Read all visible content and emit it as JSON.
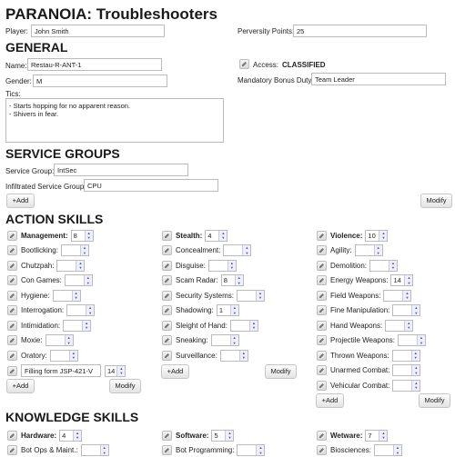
{
  "title": "PARANOIA: Troubleshooters",
  "player": {
    "label": "Player:",
    "value": "John Smith"
  },
  "perversity": {
    "label": "Perversity Points:",
    "value": "25"
  },
  "general": {
    "heading": "GENERAL",
    "name": {
      "label": "Name:",
      "value": "Restau-R-ANT-1"
    },
    "gender": {
      "label": "Gender:",
      "value": "M"
    },
    "access": {
      "label": "Access:",
      "value": "CLASSIFIED"
    },
    "duty": {
      "label": "Mandatory Bonus Duty:",
      "value": "Team Leader"
    },
    "tics": {
      "label": "Tics:",
      "lines": [
        "- Starts hopping for no apparent reason.",
        "- Shivers in fear."
      ]
    }
  },
  "service": {
    "heading": "SERVICE GROUPS",
    "group": {
      "label": "Service Group:",
      "value": "IntSec"
    },
    "infiltrated": {
      "label": "Infiltrated Service Group:",
      "value": "CPU"
    },
    "add_label": "+Add",
    "modify_label": "Modify"
  },
  "action": {
    "heading": "ACTION SKILLS",
    "add_label": "+Add",
    "modify_label": "Modify",
    "col1": {
      "head": {
        "label": "Management:",
        "value": "8"
      },
      "items": [
        {
          "label": "Bootlicking:",
          "value": ""
        },
        {
          "label": "Chutzpah:",
          "value": ""
        },
        {
          "label": "Con Games:",
          "value": ""
        },
        {
          "label": "Hygiene:",
          "value": ""
        },
        {
          "label": "Interrogation:",
          "value": ""
        },
        {
          "label": "Intimidation:",
          "value": ""
        },
        {
          "label": "Moxie:",
          "value": ""
        },
        {
          "label": "Oratory:",
          "value": ""
        }
      ],
      "custom": {
        "name": "Filling form JSP-421-V",
        "value": "14"
      }
    },
    "col2": {
      "head": {
        "label": "Stealth:",
        "value": "4"
      },
      "items": [
        {
          "label": "Concealment:",
          "value": ""
        },
        {
          "label": "Disguise:",
          "value": ""
        },
        {
          "label": "Scam Radar:",
          "value": "8"
        },
        {
          "label": "Security Systems:",
          "value": ""
        },
        {
          "label": "Shadowing:",
          "value": "1"
        },
        {
          "label": "Sleight of Hand:",
          "value": ""
        },
        {
          "label": "Sneaking:",
          "value": ""
        },
        {
          "label": "Surveillance:",
          "value": ""
        }
      ]
    },
    "col3": {
      "head": {
        "label": "Violence:",
        "value": "10"
      },
      "items": [
        {
          "label": "Agility:",
          "value": ""
        },
        {
          "label": "Demolition:",
          "value": ""
        },
        {
          "label": "Energy Weapons:",
          "value": "14"
        },
        {
          "label": "Field Weapons:",
          "value": ""
        },
        {
          "label": "Fine Manipulation:",
          "value": ""
        },
        {
          "label": "Hand Weapons:",
          "value": ""
        },
        {
          "label": "Projectile Weapons:",
          "value": ""
        },
        {
          "label": "Thrown Weapons:",
          "value": ""
        },
        {
          "label": "Unarmed Combat:",
          "value": ""
        },
        {
          "label": "Vehicular Combat:",
          "value": ""
        }
      ]
    }
  },
  "knowledge": {
    "heading": "KNOWLEDGE SKILLS",
    "col1": {
      "head": {
        "label": "Hardware:",
        "value": "4"
      },
      "items": [
        {
          "label": "Bot Ops & Maint.:",
          "value": ""
        }
      ]
    },
    "col2": {
      "head": {
        "label": "Software:",
        "value": "5"
      },
      "items": [
        {
          "label": "Bot Programming:",
          "value": ""
        }
      ]
    },
    "col3": {
      "head": {
        "label": "Wetware:",
        "value": "7"
      },
      "items": [
        {
          "label": "Biosciences:",
          "value": ""
        }
      ]
    }
  }
}
